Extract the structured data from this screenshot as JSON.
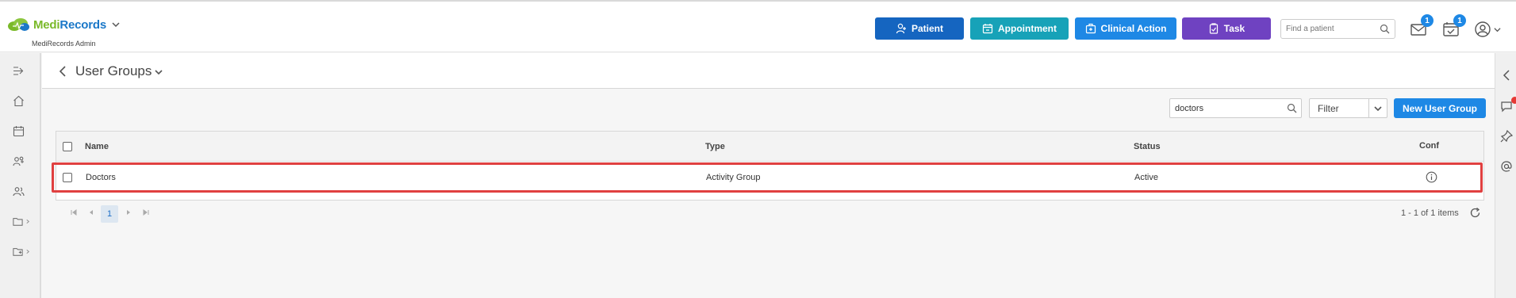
{
  "app": {
    "brand_part1": "Medi",
    "brand_part2": "Records",
    "subtitle": "MediRecords Admin"
  },
  "header": {
    "buttons": [
      {
        "label": "Patient",
        "icon": "person-add-icon",
        "color": "#1565c0"
      },
      {
        "label": "Appointment",
        "icon": "calendar-icon",
        "color": "#17a2b8"
      },
      {
        "label": "Clinical Action",
        "icon": "medical-bag-icon",
        "color": "#1e88e5"
      },
      {
        "label": "Task",
        "icon": "clipboard-icon",
        "color": "#6f42c1"
      }
    ],
    "search_placeholder": "Find a patient",
    "mail_badge": "1",
    "tasks_badge": "1"
  },
  "page": {
    "title": "User Groups",
    "search_value": "doctors",
    "filter_label": "Filter",
    "new_button": "New User Group"
  },
  "table": {
    "columns": [
      "Name",
      "Type",
      "Status",
      "Conf"
    ],
    "rows": [
      {
        "name": "Doctors",
        "type": "Activity Group",
        "status": "Active"
      }
    ]
  },
  "pager": {
    "current_page": "1",
    "summary": "1 - 1 of 1 items"
  },
  "colors": {
    "accent": "#1e88e5",
    "highlight": "#e04040"
  }
}
